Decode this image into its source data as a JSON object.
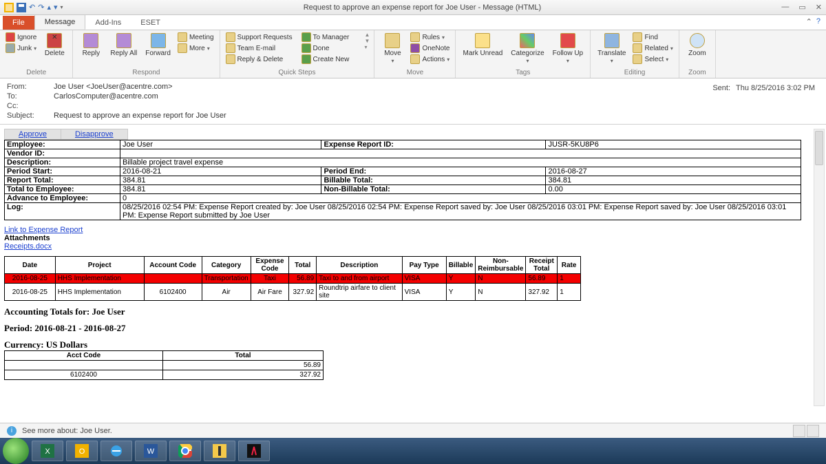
{
  "window": {
    "title": "Request to approve an expense report for Joe User - Message (HTML)"
  },
  "ribbon_tabs": {
    "file": "File",
    "message": "Message",
    "addins": "Add-Ins",
    "eset": "ESET"
  },
  "ribbon": {
    "delete": {
      "ignore": "Ignore",
      "junk": "Junk",
      "delete": "Delete",
      "group": "Delete"
    },
    "respond": {
      "reply": "Reply",
      "reply_all": "Reply\nAll",
      "forward": "Forward",
      "meeting": "Meeting",
      "more": "More",
      "group": "Respond"
    },
    "quicksteps": {
      "support": "Support Requests",
      "tomgr": "To Manager",
      "team": "Team E-mail",
      "done": "Done",
      "replydel": "Reply & Delete",
      "create": "Create New",
      "group": "Quick Steps"
    },
    "move": {
      "move": "Move",
      "rules": "Rules",
      "onenote": "OneNote",
      "actions": "Actions",
      "group": "Move"
    },
    "tags": {
      "mark": "Mark\nUnread",
      "categorize": "Categorize",
      "follow": "Follow\nUp",
      "group": "Tags"
    },
    "editing": {
      "translate": "Translate",
      "find": "Find",
      "related": "Related",
      "select": "Select",
      "group": "Editing"
    },
    "zoom": {
      "zoom": "Zoom",
      "group": "Zoom"
    }
  },
  "header": {
    "from_label": "From:",
    "from_value": "Joe User <JoeUser@acentre.com>",
    "to_label": "To:",
    "to_value": "CarlosComputer@acentre.com",
    "cc_label": "Cc:",
    "cc_value": "",
    "subject_label": "Subject:",
    "subject_value": "Request to approve an expense report for Joe User",
    "sent_label": "Sent:",
    "sent_value": "Thu 8/25/2016 3:02 PM"
  },
  "approve": {
    "approve": "Approve",
    "disapprove": "Disapprove"
  },
  "summary": {
    "employee_l": "Employee:",
    "employee_v": "Joe User",
    "erid_l": "Expense Report ID:",
    "erid_v": "JUSR-5KU8P6",
    "vendor_l": "Vendor ID:",
    "vendor_v": "",
    "desc_l": "Description:",
    "desc_v": "Billable project travel expense",
    "pstart_l": "Period Start:",
    "pstart_v": "2016-08-21",
    "pend_l": "Period End:",
    "pend_v": "2016-08-27",
    "rtotal_l": "Report Total:",
    "rtotal_v": "384.81",
    "btotal_l": "Billable Total:",
    "btotal_v": "384.81",
    "temp_l": "Total to Employee:",
    "temp_v": "384.81",
    "nbtotal_l": "Non-Billable Total:",
    "nbtotal_v": "0.00",
    "aemp_l": "Advance to Employee:",
    "aemp_v": "0",
    "log_l": "Log:",
    "log_v": "08/25/2016 02:54 PM: Expense Report created by: Joe User 08/25/2016 02:54 PM: Expense Report saved by: Joe User 08/25/2016 03:01 PM: Expense Report saved by: Joe User 08/25/2016 03:01 PM: Expense Report submitted by Joe User"
  },
  "links": {
    "expense": "Link to Expense Report",
    "attach_h": "Attachments",
    "receipt": "Receipts.docx"
  },
  "lines_head": {
    "date": "Date",
    "project": "Project",
    "acct": "Account Code",
    "cat": "Category",
    "ecode": "Expense Code",
    "total": "Total",
    "desc": "Description",
    "pay": "Pay Type",
    "bill": "Billable",
    "nonr": "Non-Reimbursable",
    "rtot": "Receipt Total",
    "rate": "Rate"
  },
  "lines": [
    {
      "date": "2016-08-25",
      "project": "HHS Implementation",
      "acct": "",
      "cat": "Transportation",
      "ecode": "Taxi",
      "total": "56.89",
      "desc": "Taxi to and from airport",
      "pay": "VISA",
      "bill": "Y",
      "nonr": "N",
      "rtot": "56.89",
      "rate": "1"
    },
    {
      "date": "2016-08-25",
      "project": "HHS Implementation",
      "acct": "6102400",
      "cat": "Air",
      "ecode": "Air Fare",
      "total": "327.92",
      "desc": "Roundtrip airfare to client site",
      "pay": "VISA",
      "bill": "Y",
      "nonr": "N",
      "rtot": "327.92",
      "rate": "1"
    }
  ],
  "acct": {
    "h1": "Accounting Totals for: Joe User",
    "h2": "Period: 2016-08-21 - 2016-08-27",
    "h3": "Currency: US Dollars",
    "col1": "Acct Code",
    "col2": "Total",
    "rows": [
      {
        "code": "",
        "total": "56.89"
      },
      {
        "code": "6102400",
        "total": "327.92"
      }
    ]
  },
  "status": {
    "text": "See more about: Joe User."
  }
}
